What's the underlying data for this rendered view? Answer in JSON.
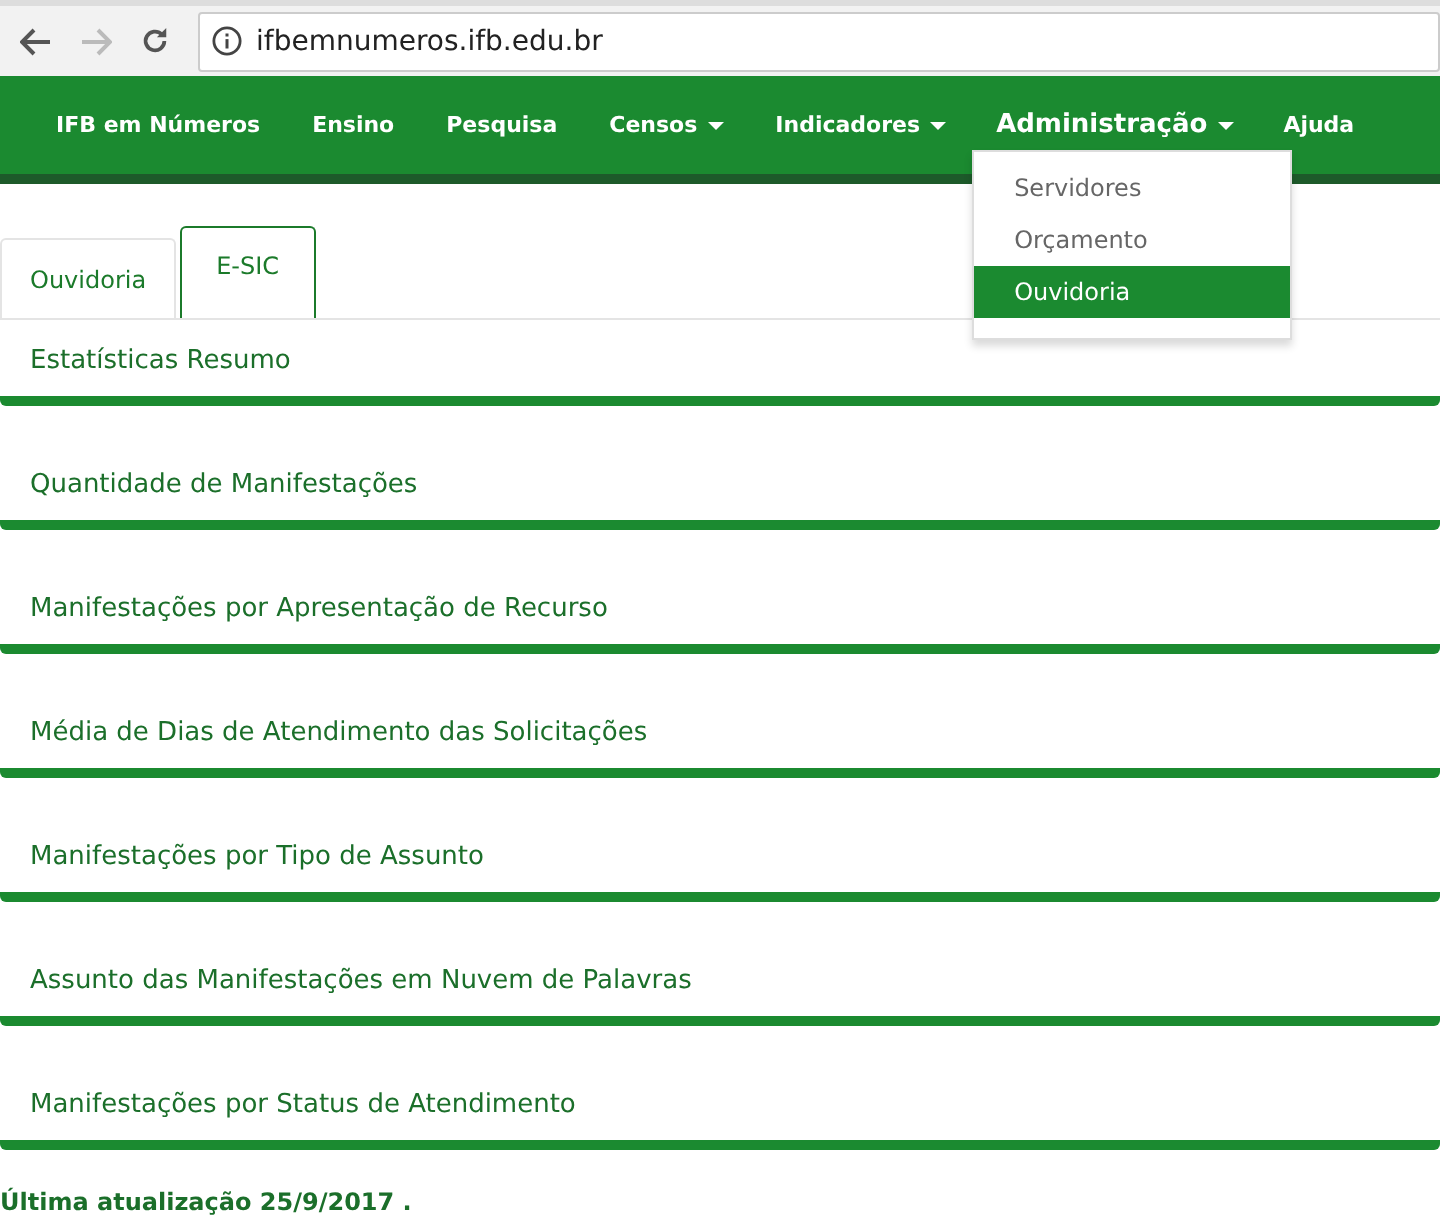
{
  "browser": {
    "url": "ifbemnumeros.ifb.edu.br"
  },
  "nav": {
    "items": [
      {
        "label": "IFB em Números",
        "dropdown": false,
        "expanded": false
      },
      {
        "label": "Ensino",
        "dropdown": false,
        "expanded": false
      },
      {
        "label": "Pesquisa",
        "dropdown": false,
        "expanded": false
      },
      {
        "label": "Censos",
        "dropdown": true,
        "expanded": false
      },
      {
        "label": "Indicadores",
        "dropdown": true,
        "expanded": false
      },
      {
        "label": "Administração",
        "dropdown": true,
        "expanded": true,
        "menu": [
          {
            "label": "Servidores",
            "selected": false
          },
          {
            "label": "Orçamento",
            "selected": false
          },
          {
            "label": "Ouvidoria",
            "selected": true
          }
        ]
      },
      {
        "label": "Ajuda",
        "dropdown": false,
        "expanded": false
      }
    ]
  },
  "tabs": [
    {
      "label": "Ouvidoria",
      "selected": false
    },
    {
      "label": "E-SIC",
      "selected": true
    }
  ],
  "panels": [
    "Estatísticas Resumo",
    "Quantidade de Manifestações",
    "Manifestações por Apresentação de Recurso",
    "Média de Dias de Atendimento das Solicitações",
    "Manifestações por Tipo de Assunto",
    "Assunto das Manifestações em Nuvem de Palavras",
    "Manifestações por Status de Atendimento"
  ],
  "footer": "Última atualização 25/9/2017 ."
}
